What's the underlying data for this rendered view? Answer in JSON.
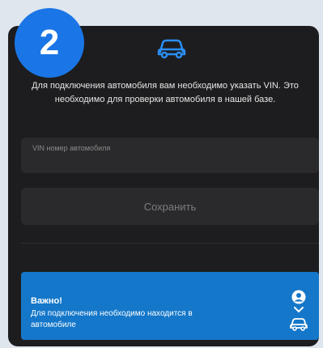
{
  "step": {
    "number": "2"
  },
  "header": {
    "icon": "car-icon"
  },
  "info": {
    "text": "Для подключения автомобиля вам необходимо указать VIN. Это необходимо для проверки автомобиля в нашей базе."
  },
  "vin_field": {
    "placeholder": "VIN номер автомобиля",
    "value": ""
  },
  "save_button": {
    "label": "Сохранить"
  },
  "banner": {
    "title": "Важно!",
    "text": "Для подключения необходимо находится в автомобиле",
    "icons": [
      "person-icon",
      "chevron-down-icon",
      "car-icon"
    ]
  },
  "colors": {
    "accent": "#1a76e6",
    "banner": "#1477c9",
    "card_bg": "#1d1d1f",
    "field_bg": "#2a2a2c"
  }
}
